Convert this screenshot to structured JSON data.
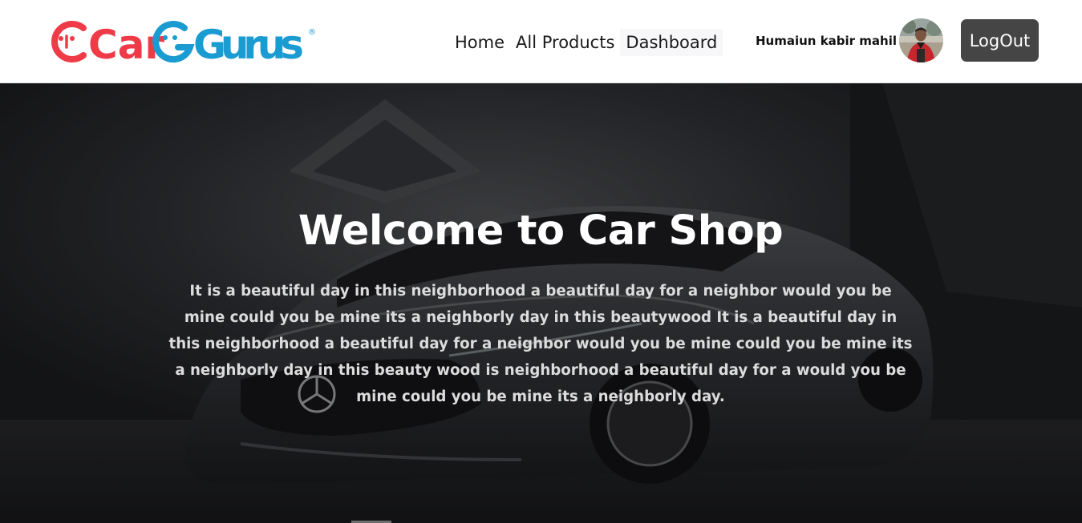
{
  "header": {
    "logo": {
      "text_part1": "Car",
      "text_part2": "Gurus",
      "registered_mark": "®",
      "color_car": "#ee3b47",
      "color_gurus": "#1a9bd1"
    },
    "nav": {
      "items": [
        {
          "label": "Home"
        },
        {
          "label": "All Products"
        },
        {
          "label": "Dashboard"
        }
      ]
    },
    "user": {
      "name": "Humaiun kabir mahil",
      "avatar_icon": "user-avatar-photo"
    },
    "logout_label": "LogOut"
  },
  "hero": {
    "title": "Welcome to Car Shop",
    "text": "It is a beautiful day in this neighborhood a beautiful day for a neighbor would you be mine could you be mine its a neighborly day in this beautywood It is a beautiful day in this neighborhood a beautiful day for a neighbor would you be mine could you be mine its a neighborly day in this beauty wood is neighborhood a beautiful day for a would you be mine could you be mine its a neighborly day.",
    "background_icon": "car-photo-background"
  },
  "colors": {
    "logout_bg": "#454545",
    "hero_bg": "#232427",
    "hero_title": "#ffffff",
    "hero_text": "#dcdcdc"
  }
}
